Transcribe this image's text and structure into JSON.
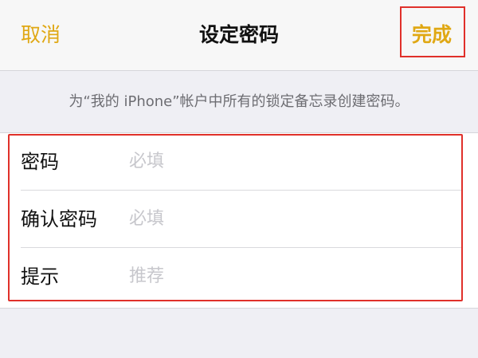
{
  "nav": {
    "cancel_label": "取消",
    "title": "设定密码",
    "done_label": "完成"
  },
  "info": {
    "text": "为“我的 iPhone”帐户中所有的锁定备忘录创建密码。"
  },
  "form": {
    "rows": [
      {
        "label": "密码",
        "placeholder": "必填",
        "value": ""
      },
      {
        "label": "确认密码",
        "placeholder": "必填",
        "value": ""
      },
      {
        "label": "提示",
        "placeholder": "推荐",
        "value": ""
      }
    ]
  },
  "colors": {
    "accent": "#e0a814",
    "highlight": "#e0302a",
    "background": "#efeff4"
  }
}
